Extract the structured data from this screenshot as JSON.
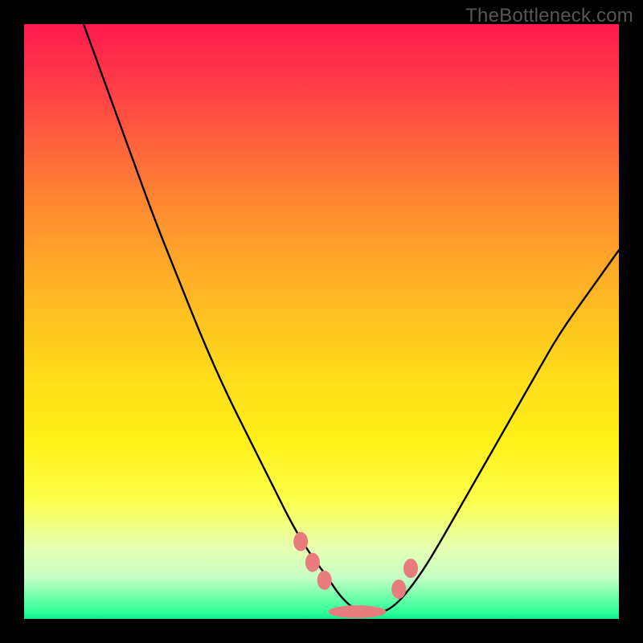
{
  "watermark": "TheBottleneck.com",
  "chart_data": {
    "type": "line",
    "title": "",
    "xlabel": "",
    "ylabel": "",
    "xlim": [
      0,
      100
    ],
    "ylim": [
      0,
      100
    ],
    "series": [
      {
        "name": "curve",
        "x": [
          10,
          14,
          18,
          22,
          26,
          30,
          34,
          38,
          42,
          45,
          48,
          51,
          53,
          55,
          57,
          60,
          62,
          64,
          67,
          70,
          74,
          78,
          82,
          86,
          90,
          95,
          100
        ],
        "y": [
          100,
          89,
          78,
          67,
          57,
          47,
          38,
          30,
          22,
          16,
          11,
          7,
          4,
          2,
          1,
          1,
          2,
          4,
          8,
          13,
          20,
          27,
          34,
          41,
          48,
          55,
          62
        ]
      }
    ],
    "markers": {
      "name": "dip-cluster",
      "color": "#e87c7c",
      "points": [
        {
          "x": 46.5,
          "y": 13
        },
        {
          "x": 48.5,
          "y": 9.5
        },
        {
          "x": 50.5,
          "y": 6.5
        },
        {
          "x": 56,
          "y": 1.2,
          "elongated": true
        },
        {
          "x": 63,
          "y": 5
        },
        {
          "x": 65,
          "y": 8.5
        }
      ]
    },
    "gradient_stops": [
      {
        "y": 0,
        "color": "#ff1a4e"
      },
      {
        "y": 22,
        "color": "#ff6a3b"
      },
      {
        "y": 45,
        "color": "#ffb524"
      },
      {
        "y": 70,
        "color": "#fff018"
      },
      {
        "y": 88,
        "color": "#e6ffb0"
      },
      {
        "y": 99,
        "color": "#2aff97"
      }
    ]
  }
}
